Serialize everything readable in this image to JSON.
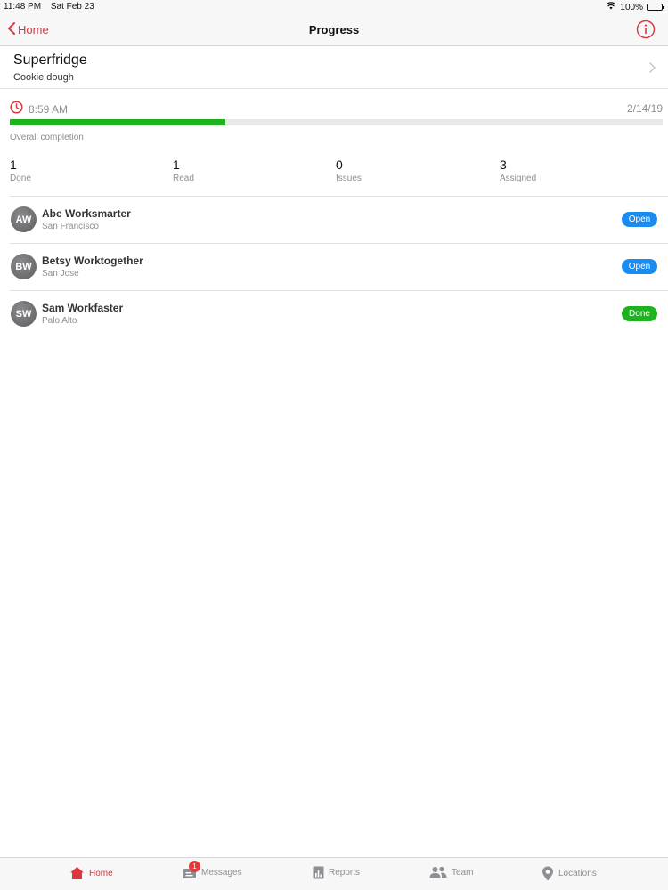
{
  "status_bar": {
    "time": "11:48 PM",
    "date": "Sat Feb 23",
    "battery": "100%"
  },
  "nav": {
    "back_label": "Home",
    "title": "Progress"
  },
  "task": {
    "title": "Superfridge",
    "subtitle": "Cookie dough",
    "time": "8:59 AM",
    "date": "2/14/19",
    "completion_label": "Overall completion",
    "completion_fraction": 0.33
  },
  "stats": [
    {
      "value": "1",
      "label": "Done"
    },
    {
      "value": "1",
      "label": "Read"
    },
    {
      "value": "0",
      "label": "Issues"
    },
    {
      "value": "3",
      "label": "Assigned"
    }
  ],
  "people": [
    {
      "initials": "AW",
      "name": "Abe Worksmarter",
      "location": "San Francisco",
      "status": "Open"
    },
    {
      "initials": "BW",
      "name": "Betsy Worktogether",
      "location": "San Jose",
      "status": "Open"
    },
    {
      "initials": "SW",
      "name": "Sam Workfaster",
      "location": "Palo Alto",
      "status": "Done"
    }
  ],
  "colors": {
    "accent": "#d9363e",
    "open_badge": "#1a8cf0",
    "done_badge": "#1fb21f",
    "progress": "#1fb21f"
  },
  "tabs": [
    {
      "label": "Home",
      "icon": "home-icon",
      "active": true
    },
    {
      "label": "Messages",
      "icon": "messages-icon",
      "badge": "1"
    },
    {
      "label": "Reports",
      "icon": "reports-icon"
    },
    {
      "label": "Team",
      "icon": "team-icon"
    },
    {
      "label": "Locations",
      "icon": "location-pin-icon"
    }
  ]
}
